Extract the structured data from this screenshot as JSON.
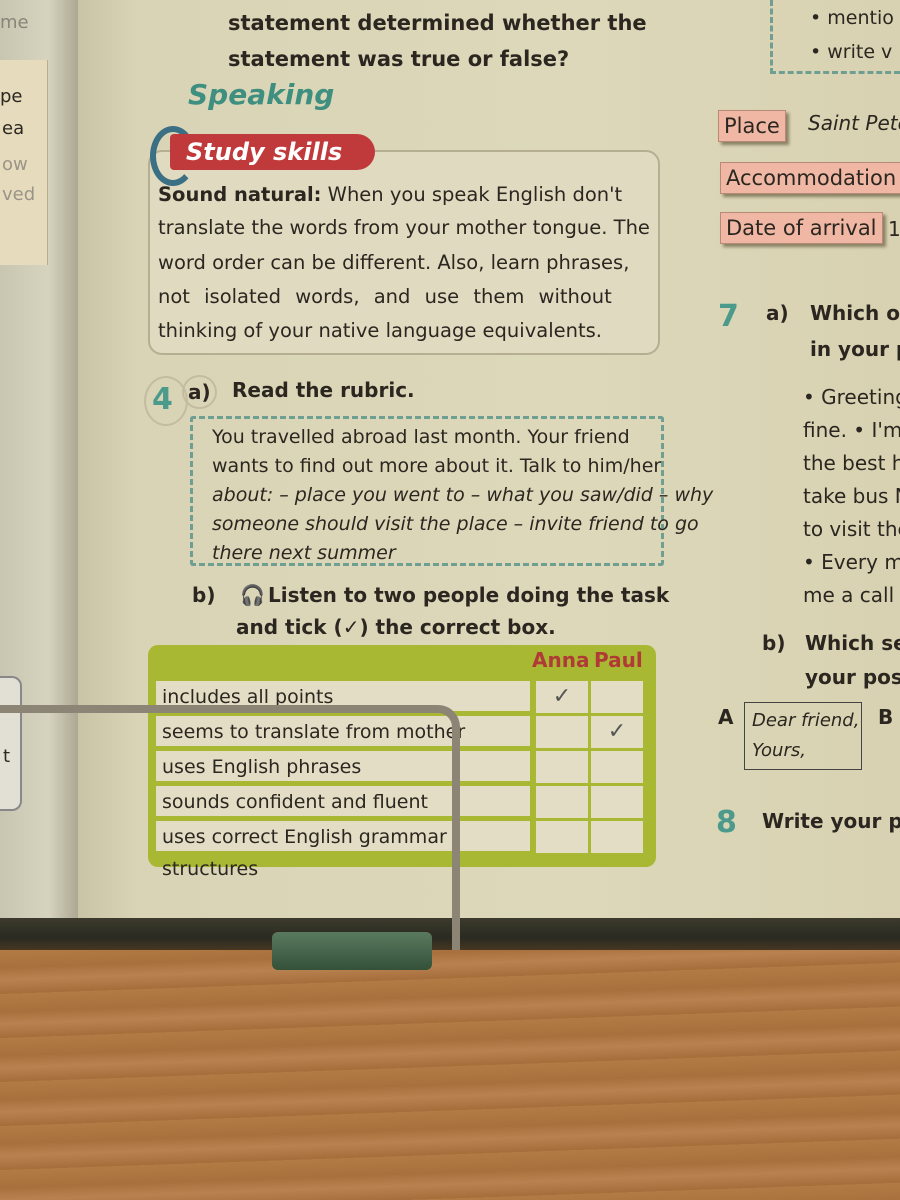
{
  "top_text": {
    "line1": "statement determined whether the",
    "line2": "statement was true or false?"
  },
  "speaking": "Speaking",
  "study_skills": {
    "banner": "Study skills",
    "lead": "Sound natural:",
    "lines": [
      " When you speak English don't",
      "translate the words from your mother tongue. The",
      "word order can be different. Also, learn phrases,",
      "not isolated words, and use them without",
      "thinking of your native language equivalents."
    ]
  },
  "task4": {
    "number": "4",
    "a_label": "a)",
    "a_text": "Read the rubric.",
    "rubric": [
      "You travelled abroad last month. Your friend",
      "wants to find out more about it. Talk to him/her",
      "about: – place you went to – what you saw/did – why",
      "someone should visit the place – invite friend to go",
      "there next summer"
    ],
    "b_label": "b)",
    "b_line1": "Listen to two people doing the task",
    "b_line2": "and tick (✓) the correct box."
  },
  "grid": {
    "columns": [
      "Anna",
      "Paul"
    ],
    "rows": [
      {
        "label": "includes all points",
        "anna": "✓",
        "paul": ""
      },
      {
        "label": "seems to translate from mother tongue",
        "anna": "",
        "paul": "✓"
      },
      {
        "label": "uses English phrases",
        "anna": "",
        "paul": ""
      },
      {
        "label": "sounds confident and fluent",
        "anna": "",
        "paul": ""
      },
      {
        "label": "uses correct English grammar structures",
        "anna": "",
        "paul": ""
      }
    ]
  },
  "right": {
    "bullets": [
      "mentio",
      "write v"
    ],
    "tags": [
      {
        "label": "Place",
        "value": "Saint Pete"
      },
      {
        "label": "Accommodation",
        "value": ""
      },
      {
        "label": "Date of arrival",
        "value": "1"
      }
    ],
    "task7": {
      "number": "7",
      "a_label": "a)",
      "a_lines": [
        "Which of",
        "in your p"
      ],
      "body": [
        "• Greeting",
        "fine. • I'm",
        "the best h",
        "take bus N",
        "to visit the",
        "• Every mo",
        "me a call la"
      ],
      "b_label": "b)",
      "b_lines": [
        "Which set",
        "your post"
      ],
      "optA": "A",
      "optA_lines": [
        "Dear friend,",
        "Yours,"
      ],
      "optB": "B"
    },
    "task8": {
      "number": "8",
      "text": "Write your p"
    }
  },
  "left_edge": [
    "me",
    "pe",
    "ea",
    "ow",
    "ved",
    "t"
  ],
  "colors": {
    "speaking": "#3f8f80",
    "banner": "#c03a3c",
    "grid": "#a9b832",
    "names": "#b03a36",
    "tags": "#f0b8a4"
  }
}
